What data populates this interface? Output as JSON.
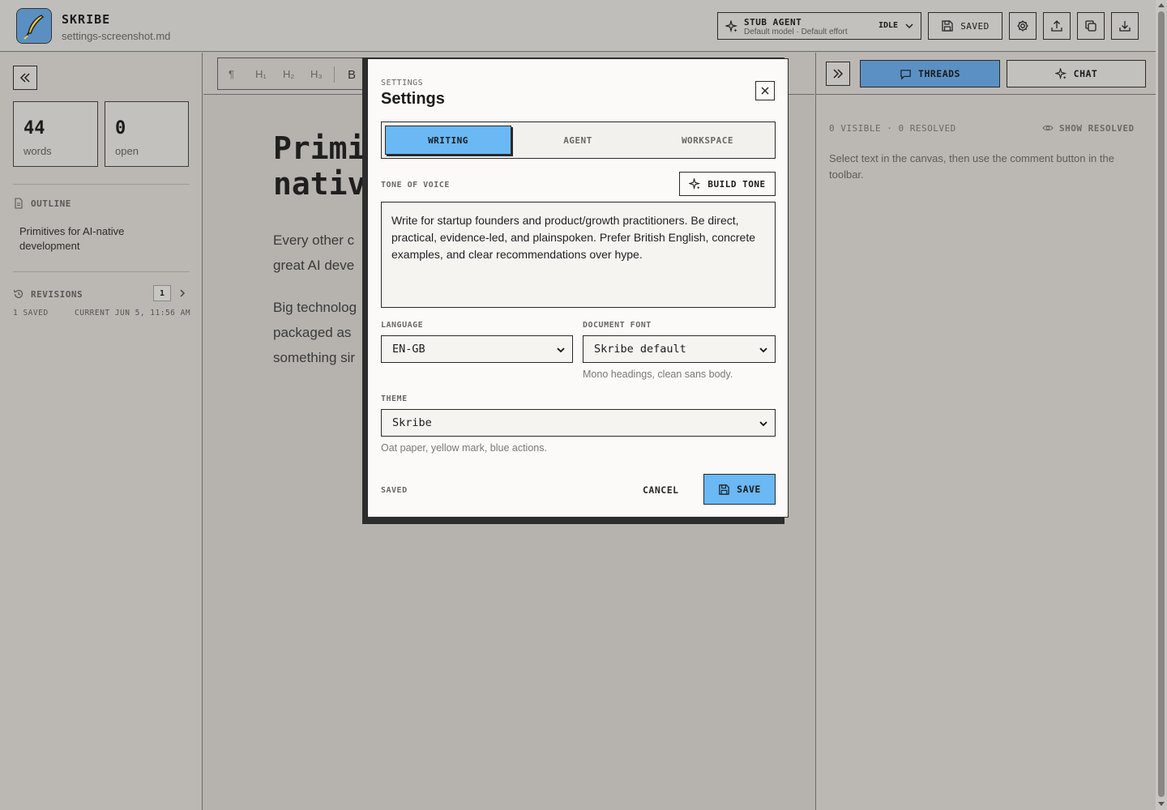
{
  "app": {
    "title": "SKRIBE",
    "filename": "settings-screenshot.md"
  },
  "agent": {
    "name": "STUB AGENT",
    "subtitle": "Default model · Default effort",
    "status": "IDLE"
  },
  "header": {
    "saved_label": "SAVED"
  },
  "stats": {
    "words": "44",
    "words_label": "words",
    "open": "0",
    "open_label": "open"
  },
  "outline": {
    "heading": "OUTLINE",
    "items": [
      "Primitives for AI-native development"
    ]
  },
  "revisions": {
    "heading": "REVISIONS",
    "count": "1",
    "saved": "1 SAVED",
    "current": "CURRENT JUN 5, 11:56 AM"
  },
  "toolbar": {
    "paragraph": "¶",
    "h1": "H₁",
    "h2": "H₂",
    "h3": "H₃",
    "bold": "B"
  },
  "document": {
    "title_line1": "Primi",
    "title_line2": "nativ",
    "p1": "Every other c\ngreat AI deve",
    "p2": "Big technolog\npackaged as\nsomething sir"
  },
  "right_panel": {
    "threads_label": "THREADS",
    "chat_label": "CHAT",
    "meta": "0 VISIBLE · 0 RESOLVED",
    "show_resolved": "SHOW RESOLVED",
    "hint": "Select text in the canvas, then use the comment button in the toolbar."
  },
  "modal": {
    "kicker": "SETTINGS",
    "title": "Settings",
    "tabs": [
      "WRITING",
      "AGENT",
      "WORKSPACE"
    ],
    "active_tab": "WRITING",
    "tone_label": "TONE OF VOICE",
    "build_tone": "BUILD TONE",
    "tone_text": "Write for startup founders and product/growth practitioners. Be direct, practical, evidence-led, and plainspoken. Prefer British English, concrete examples, and clear recommendations over hype.",
    "language_label": "LANGUAGE",
    "language_value": "EN-GB",
    "font_label": "DOCUMENT FONT",
    "font_value": "Skribe default",
    "font_help": "Mono headings, clean sans body.",
    "theme_label": "THEME",
    "theme_value": "Skribe",
    "theme_help": "Oat paper, yellow mark, blue actions.",
    "status": "SAVED",
    "cancel": "CANCEL",
    "save": "SAVE"
  },
  "colors": {
    "accent": "#6ab8f4",
    "accent_dim": "#5b90c4",
    "paper": "#fbfaf8",
    "overlay_bg": "#b9b6b1"
  },
  "icons": [
    "feather-logo-icon",
    "sparkle-icon",
    "chevron-down-icon",
    "save-icon",
    "gear-icon",
    "upload-icon",
    "copy-icon",
    "download-icon",
    "collapse-left-icon",
    "document-icon",
    "history-icon",
    "chevron-right-icon",
    "expand-right-icon",
    "chat-bubble-icon",
    "eye-icon",
    "close-icon"
  ]
}
